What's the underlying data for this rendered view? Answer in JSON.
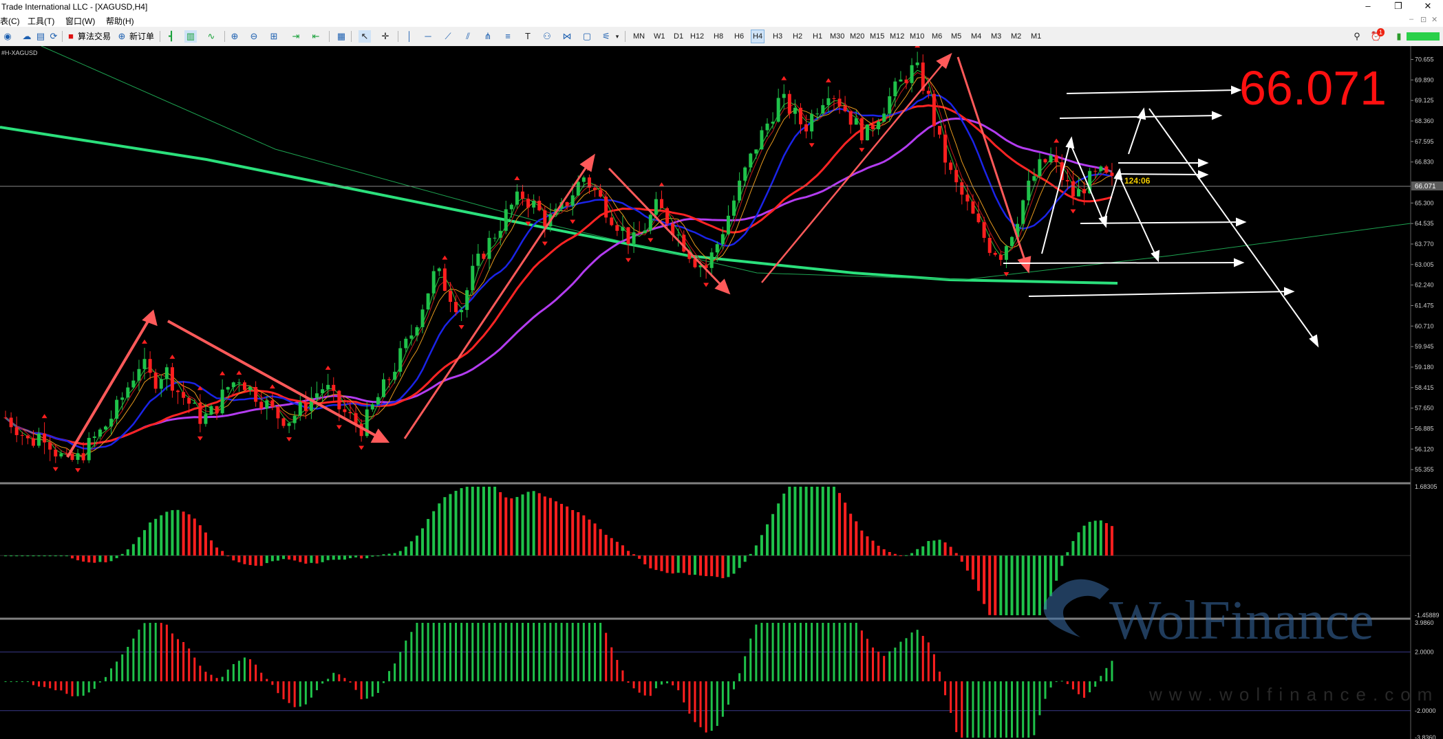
{
  "window": {
    "title": "Trade International LLC - [XAGUSD,H4]",
    "minimize_glyph": "–",
    "restore_glyph": "❐",
    "close_glyph": "✕"
  },
  "menu": {
    "items": [
      "表(C)",
      "工具(T)",
      "窗口(W)",
      "帮助(H)"
    ],
    "right_controls": [
      "–",
      "⊡",
      "✕"
    ]
  },
  "toolbar": {
    "algo_trading_label": "算法交易",
    "new_order_label": "新订单",
    "timeframes": [
      "MN",
      "W1",
      "D1",
      "H12",
      "H8",
      "H6",
      "H4",
      "H3",
      "H2",
      "H1",
      "M30",
      "M20",
      "M15",
      "M12",
      "M10",
      "M6",
      "M5",
      "M4",
      "M3",
      "M2",
      "M1"
    ],
    "active_timeframe": "H4",
    "notification_count": "1"
  },
  "chart_data": {
    "type": "candlestick",
    "symbol_label": "#H-XAGUSD",
    "big_price_label": "66.071",
    "countdown_label": "124:06",
    "current_price_label": "66.071",
    "main_price_axis": [
      "70.655",
      "69.890",
      "69.125",
      "68.360",
      "67.595",
      "66.830",
      "66.071",
      "65.300",
      "64.535",
      "63.770",
      "63.005",
      "62.240",
      "61.475",
      "60.710",
      "59.945",
      "59.180",
      "58.415",
      "57.650",
      "56.885",
      "56.120",
      "55.355"
    ],
    "main_ylim": [
      55.0,
      71.0
    ],
    "candle_closes": [
      57.3,
      56.9,
      56.3,
      56.8,
      56.1,
      55.6,
      55.8,
      56.4,
      56.9,
      57.6,
      58.5,
      59.4,
      58.6,
      59.1,
      58.3,
      57.8,
      57.2,
      57.6,
      58.4,
      58.8,
      58.3,
      57.9,
      57.4,
      57.2,
      57.6,
      58.1,
      58.5,
      57.7,
      57.3,
      56.9,
      57.8,
      58.6,
      59.5,
      60.4,
      61.6,
      62.8,
      62.0,
      61.3,
      62.7,
      63.6,
      64.3,
      65.1,
      65.6,
      65.2,
      64.6,
      64.9,
      65.6,
      66.3,
      65.7,
      65.0,
      64.4,
      63.8,
      64.4,
      65.2,
      64.6,
      63.9,
      63.2,
      62.9,
      63.9,
      65.1,
      66.3,
      67.4,
      68.3,
      69.2,
      68.7,
      68.1,
      68.9,
      69.6,
      69.0,
      68.3,
      67.8,
      68.6,
      69.3,
      69.9,
      70.4,
      69.3,
      67.5,
      66.2,
      65.4,
      64.5,
      63.7,
      63.4,
      64.4,
      65.7,
      66.6,
      67.0,
      66.2,
      65.5,
      66.1,
      66.4,
      66.071
    ],
    "indicator1_axis": [
      "1.68305",
      "-1.45889"
    ],
    "indicator1_ylim": [
      -1.45889,
      1.68305
    ],
    "indicator2_axis": [
      "3.9860",
      "2.0000",
      "-2.0000",
      "-3.8360"
    ],
    "indicator2_ylim": [
      -3.836,
      3.986
    ],
    "watermark_brand": "WolFinance",
    "watermark_url": "www.wolfinance.com",
    "colors": {
      "bull": "#1fc24a",
      "bear": "#ff1f1f",
      "ma_green": "#2be07c",
      "ma_red": "#ff2424",
      "ma_purple": "#b33cf0",
      "ma_blue": "#1b24e8",
      "arrow_red": "#ff5a5a",
      "arrow_white": "#ffffff",
      "big_price": "#ff1010",
      "countdown": "#f2cc00"
    }
  }
}
